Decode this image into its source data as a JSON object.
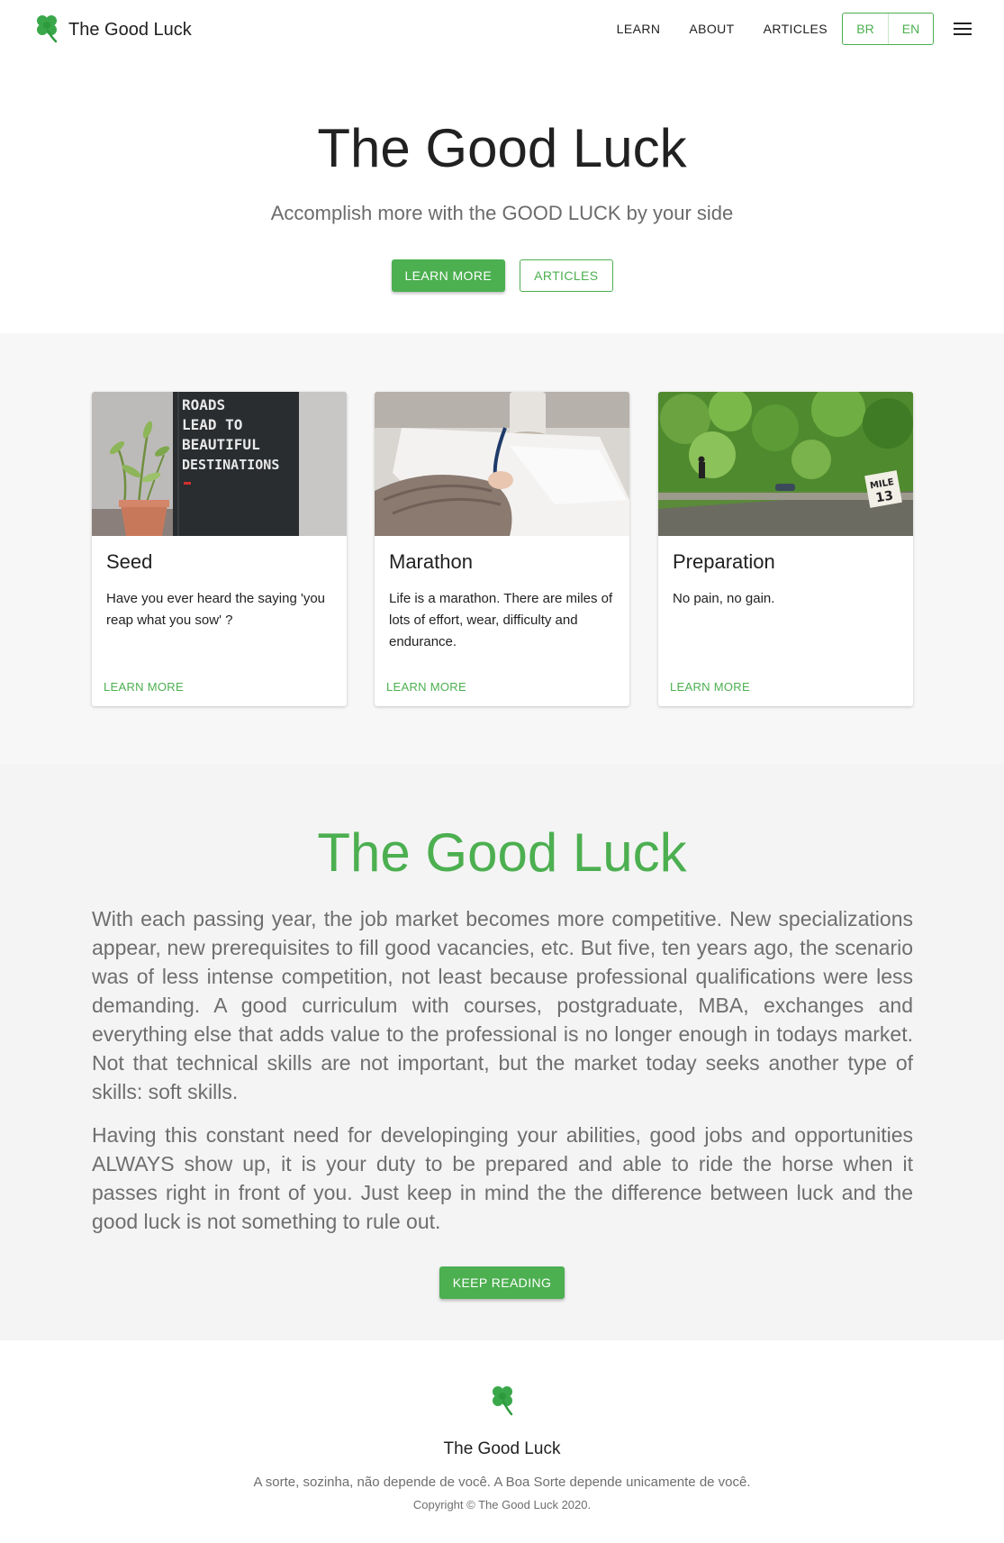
{
  "header": {
    "brand": "The Good Luck",
    "logo_icon": "clover-icon",
    "nav": [
      "LEARN",
      "ABOUT",
      "ARTICLES"
    ],
    "languages": [
      "BR",
      "EN"
    ],
    "menu_icon": "hamburger-menu-icon"
  },
  "hero": {
    "title": "The Good Luck",
    "subtitle": "Accomplish more with the GOOD LUCK by your side",
    "primary_button": "LEARN MORE",
    "secondary_button": "ARTICLES"
  },
  "cards": [
    {
      "title": "Seed",
      "text": "Have you ever heard the saying 'you reap what you sow' ?",
      "action": "LEARN MORE",
      "image_text": [
        "ROADS",
        "LEAD TO",
        "BEAUTIFUL",
        "DESTINATIONS"
      ]
    },
    {
      "title": "Marathon",
      "text": "Life is a marathon. There are miles of lots of effort, wear, difficulty and endurance.",
      "action": "LEARN MORE"
    },
    {
      "title": "Preparation",
      "text": "No pain, no gain.",
      "action": "LEARN MORE",
      "image_text": [
        "MILE",
        "13"
      ]
    }
  ],
  "about": {
    "title": "The Good Luck",
    "paragraph1": "With each passing year, the job market becomes more competitive. New specializations appear, new prerequisites to fill good vacancies, etc. But five, ten years ago, the scenario was of less intense competition, not least because professional qualifications were less demanding. A good curriculum with courses, postgraduate, MBA, exchanges and everything else that adds value to the professional is no longer enough in todays market. Not that technical skills are not important, but the market today seeks another type of skills: soft skills.",
    "paragraph2": "Having this constant need for developinging your abilities, good jobs and opportunities ALWAYS show up, it is your duty to be prepared and able to ride the horse when it passes right in front of you. Just keep in mind the the difference between luck and the good luck is not something to rule out.",
    "button": "KEEP READING"
  },
  "footer": {
    "brand": "The Good Luck",
    "tagline": "A sorte, sozinha, não depende de você. A Boa Sorte depende unicamente de você.",
    "copyright": "Copyright © The Good Luck 2020."
  },
  "colors": {
    "accent": "#4caf50",
    "section_bg": "#f4f4f4"
  }
}
